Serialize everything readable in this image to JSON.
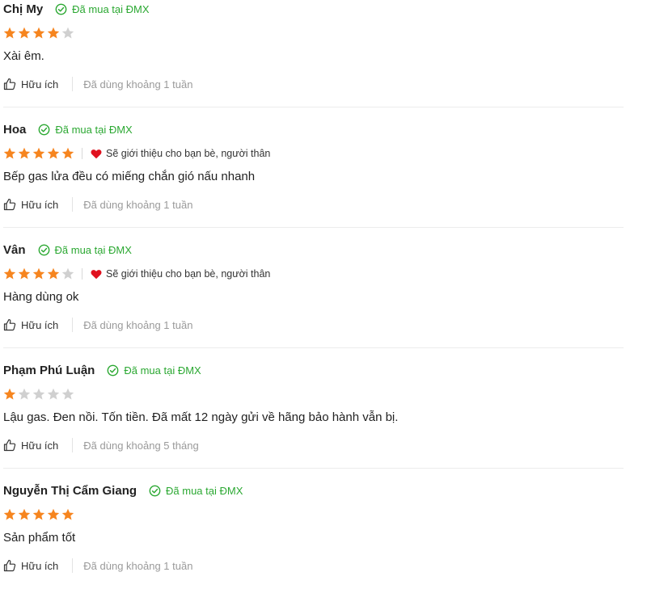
{
  "colors": {
    "star_filled": "#f6851f",
    "star_empty": "#d0d0d0",
    "verified": "#2ba832",
    "heart": "#e0111f"
  },
  "icons": {
    "verified": "check-circle-icon",
    "star": "star-icon",
    "heart": "heart-icon",
    "helpful": "thumbs-up-icon"
  },
  "reviews": [
    {
      "name": "Chị My",
      "bought": "Đã mua tại ĐMX",
      "rating": 4,
      "recommend": "",
      "content": "Xài êm.",
      "helpful": "Hữu ích",
      "used": "Đã dùng khoảng 1 tuần"
    },
    {
      "name": "Hoa",
      "bought": "Đã mua tại ĐMX",
      "rating": 5,
      "recommend": "Sẽ giới thiệu cho bạn bè, người thân",
      "content": "Bếp gas lửa đều có miếng chắn gió nấu nhanh",
      "helpful": "Hữu ích",
      "used": "Đã dùng khoảng 1 tuần"
    },
    {
      "name": "Vân",
      "bought": "Đã mua tại ĐMX",
      "rating": 4,
      "recommend": "Sẽ giới thiệu cho bạn bè, người thân",
      "content": "Hàng dùng ok",
      "helpful": "Hữu ích",
      "used": "Đã dùng khoảng 1 tuần"
    },
    {
      "name": "Phạm Phú Luận",
      "bought": "Đã mua tại ĐMX",
      "rating": 1,
      "recommend": "",
      "content": "Lậu gas. Đen nồi. Tốn tiền. Đã mất 12 ngày gửi về hãng bảo hành vẫn bị.",
      "helpful": "Hữu ích",
      "used": "Đã dùng khoảng 5 tháng"
    },
    {
      "name": "Nguyễn Thị Cẩm Giang",
      "bought": "Đã mua tại ĐMX",
      "rating": 5,
      "recommend": "",
      "content": "Sản phẩm tốt",
      "helpful": "Hữu ích",
      "used": "Đã dùng khoảng 1 tuần"
    }
  ]
}
